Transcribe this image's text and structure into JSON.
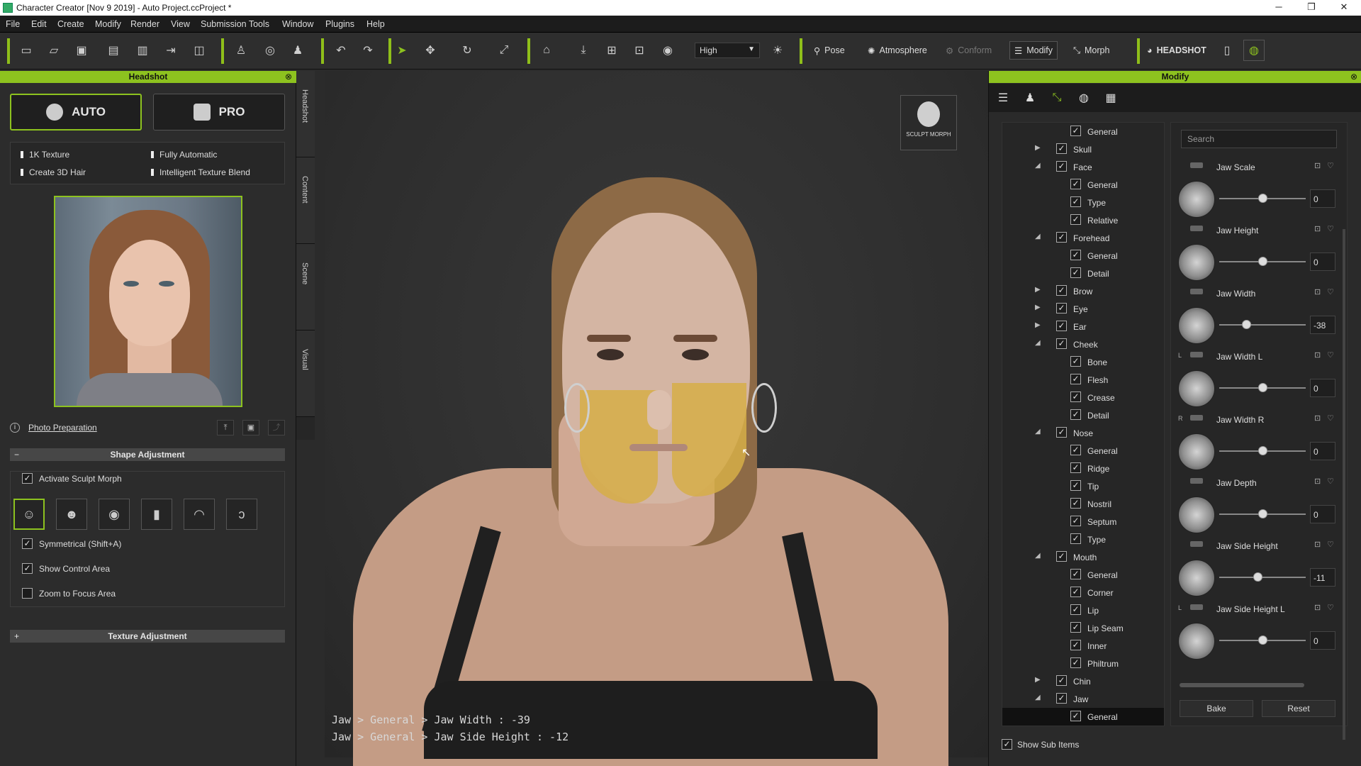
{
  "window": {
    "title": "Character Creator [Nov  9 2019] - Auto Project.ccProject *",
    "min": "─",
    "restore": "❐",
    "close": "✕"
  },
  "menu": [
    "File",
    "Edit",
    "Create",
    "Modify",
    "Render",
    "View",
    "Submission Tools",
    "Window",
    "Plugins",
    "Help"
  ],
  "toolbar": {
    "quality": "High",
    "pose": "Pose",
    "atmosphere": "Atmosphere",
    "conform": "Conform",
    "modify": "Modify",
    "morph": "Morph",
    "headshot": "HEADSHOT"
  },
  "headshot_panel": {
    "title": "Headshot",
    "auto": "AUTO",
    "pro": "PRO",
    "features": [
      "1K Texture",
      "Fully Automatic",
      "Create 3D Hair",
      "Intelligent Texture Blend"
    ],
    "photo_prep": "Photo Preparation",
    "shape_adjustment": "Shape Adjustment",
    "texture_adjustment": "Texture Adjustment",
    "activate_sculpt": "Activate Sculpt Morph",
    "symmetrical": "Symmetrical (Shift+A)",
    "show_control": "Show Control Area",
    "zoom_focus": "Zoom to Focus Area",
    "activate_checked": true,
    "symmetrical_checked": true,
    "show_control_checked": true,
    "zoom_checked": false
  },
  "side_tabs": [
    "Headshot",
    "Content",
    "Scene",
    "Visual"
  ],
  "viewport": {
    "sculpt_morph": "SCULPT MORPH",
    "info1": "Jaw > General > Jaw Width : -39",
    "info2": "Jaw > General > Jaw Side Height : -12"
  },
  "modify_panel": {
    "title": "Modify",
    "search_placeholder": "Search",
    "bake": "Bake",
    "reset": "Reset",
    "show_sub": "Show Sub Items"
  },
  "tree": [
    {
      "label": "General",
      "level": 1,
      "tw": ""
    },
    {
      "label": "Skull",
      "level": 0,
      "tw": "▶"
    },
    {
      "label": "Face",
      "level": 0,
      "tw": "◢"
    },
    {
      "label": "General",
      "level": 1,
      "tw": ""
    },
    {
      "label": "Type",
      "level": 1,
      "tw": ""
    },
    {
      "label": "Relative",
      "level": 1,
      "tw": ""
    },
    {
      "label": "Forehead",
      "level": 0,
      "tw": "◢"
    },
    {
      "label": "General",
      "level": 1,
      "tw": ""
    },
    {
      "label": "Detail",
      "level": 1,
      "tw": ""
    },
    {
      "label": "Brow",
      "level": 0,
      "tw": "▶"
    },
    {
      "label": "Eye",
      "level": 0,
      "tw": "▶"
    },
    {
      "label": "Ear",
      "level": 0,
      "tw": "▶"
    },
    {
      "label": "Cheek",
      "level": 0,
      "tw": "◢"
    },
    {
      "label": "Bone",
      "level": 1,
      "tw": ""
    },
    {
      "label": "Flesh",
      "level": 1,
      "tw": ""
    },
    {
      "label": "Crease",
      "level": 1,
      "tw": ""
    },
    {
      "label": "Detail",
      "level": 1,
      "tw": ""
    },
    {
      "label": "Nose",
      "level": 0,
      "tw": "◢"
    },
    {
      "label": "General",
      "level": 1,
      "tw": ""
    },
    {
      "label": "Ridge",
      "level": 1,
      "tw": ""
    },
    {
      "label": "Tip",
      "level": 1,
      "tw": ""
    },
    {
      "label": "Nostril",
      "level": 1,
      "tw": ""
    },
    {
      "label": "Septum",
      "level": 1,
      "tw": ""
    },
    {
      "label": "Type",
      "level": 1,
      "tw": ""
    },
    {
      "label": "Mouth",
      "level": 0,
      "tw": "◢"
    },
    {
      "label": "General",
      "level": 1,
      "tw": ""
    },
    {
      "label": "Corner",
      "level": 1,
      "tw": ""
    },
    {
      "label": "Lip",
      "level": 1,
      "tw": ""
    },
    {
      "label": "Lip Seam",
      "level": 1,
      "tw": ""
    },
    {
      "label": "Inner",
      "level": 1,
      "tw": ""
    },
    {
      "label": "Philtrum",
      "level": 1,
      "tw": ""
    },
    {
      "label": "Chin",
      "level": 0,
      "tw": "▶"
    },
    {
      "label": "Jaw",
      "level": 0,
      "tw": "◢"
    },
    {
      "label": "General",
      "level": 1,
      "tw": "",
      "selected": true
    }
  ],
  "sliders": [
    {
      "name": "Jaw Scale",
      "value": "0",
      "side": "",
      "level": 0.5
    },
    {
      "name": "Jaw Height",
      "value": "0",
      "side": "",
      "level": 0.5
    },
    {
      "name": "Jaw Width",
      "value": "-38",
      "side": "",
      "level": 0.31
    },
    {
      "name": "Jaw Width L",
      "value": "0",
      "side": "L",
      "level": 0.5
    },
    {
      "name": "Jaw Width R",
      "value": "0",
      "side": "R",
      "level": 0.5
    },
    {
      "name": "Jaw Depth",
      "value": "0",
      "side": "",
      "level": 0.5
    },
    {
      "name": "Jaw Side Height",
      "value": "-11",
      "side": "",
      "level": 0.445
    },
    {
      "name": "Jaw Side Height L",
      "value": "0",
      "side": "L",
      "level": 0.5
    }
  ]
}
